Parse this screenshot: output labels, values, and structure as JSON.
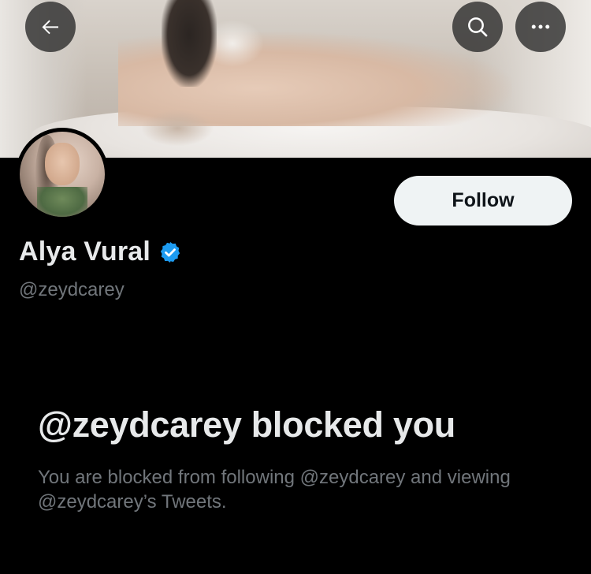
{
  "header": {
    "back_icon": "arrow-left-icon",
    "search_icon": "search-icon",
    "more_icon": "more-horizontal-icon"
  },
  "profile": {
    "display_name": "Alya Vural",
    "handle": "@zeydcarey",
    "verified": true,
    "verified_color": "#1d9bf0",
    "follow_label": "Follow"
  },
  "blocked_notice": {
    "title": "@zeydcarey blocked you",
    "description": "You are blocked from following @zeydcarey and viewing @zeydcarey’s Tweets."
  },
  "colors": {
    "background": "#000000",
    "primary_text": "#e7e9ea",
    "secondary_text": "#71767b",
    "follow_button_bg": "#eff3f4",
    "follow_button_text": "#0f1419"
  }
}
